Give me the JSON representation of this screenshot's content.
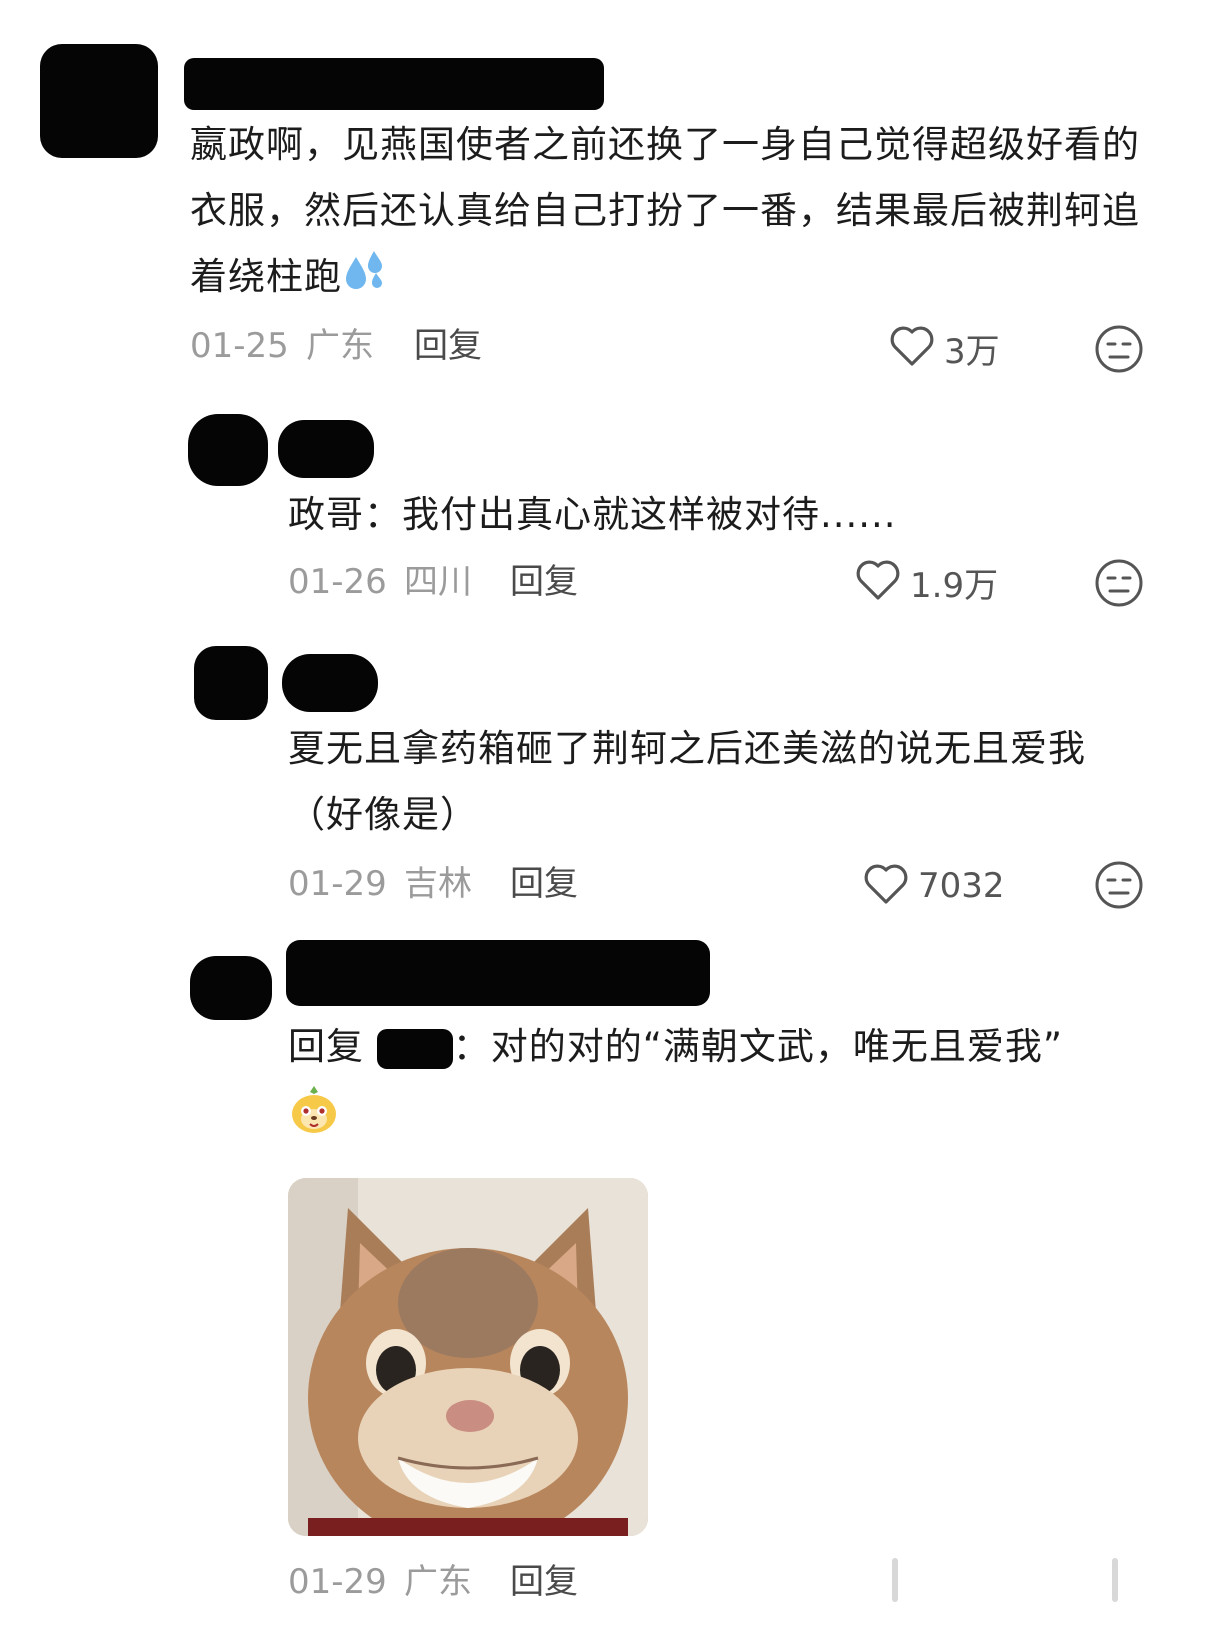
{
  "comments": [
    {
      "text": "嬴政啊，见燕国使者之前还换了一身自己觉得超级好看的衣服，然后还认真给自己打扮了一番，结果最后被荆轲追着绕柱跑",
      "date": "01-25",
      "location": "广东",
      "reply_label": "回复",
      "likes": "3万"
    },
    {
      "text": "政哥：我付出真心就这样被对待......",
      "date": "01-26",
      "location": "四川",
      "reply_label": "回复",
      "likes": "1.9万"
    },
    {
      "text": "夏无且拿药箱砸了荆轲之后还美滋的说无且爱我（好像是）",
      "date": "01-29",
      "location": "吉林",
      "reply_label": "回复",
      "likes": "7032"
    },
    {
      "reply_prefix": "回复",
      "text": "：对的对的“满朝文武，唯无且爱我”",
      "date": "01-29",
      "location": "广东",
      "reply_label": "回复"
    }
  ],
  "icons": {
    "like": "heart-outline-icon",
    "dislike": "neutral-face-icon",
    "sweat": "sweat-droplets-emoji",
    "sticker": "dog-face-sticker-emoji"
  },
  "colors": {
    "meta": "#9b9b9b",
    "text": "#1c1c1c",
    "redaction": "#050505"
  }
}
